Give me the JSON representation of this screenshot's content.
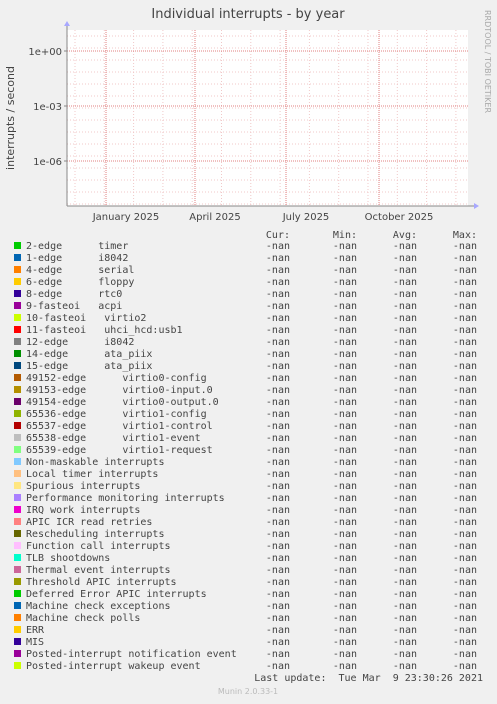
{
  "chart_data": {
    "type": "line",
    "title": "Individual interrupts - by year",
    "ylabel": "interrupts / second",
    "xlabel": "",
    "y_scale": "log",
    "y_ticks": [
      "1e+00",
      "1e-03",
      "1e-06"
    ],
    "x_ticks": [
      "January 2025",
      "April 2025",
      "July 2025",
      "October 2025"
    ],
    "grid": true,
    "side_label": "RRDTOOL / TOBI OETIKER",
    "legend_columns": [
      "Cur:",
      "Min:",
      "Avg:",
      "Max:"
    ],
    "series": [
      {
        "name": "2-edge      timer",
        "color": "#00cc00",
        "cur": "-nan",
        "min": "-nan",
        "avg": "-nan",
        "max": "-nan"
      },
      {
        "name": "1-edge      i8042",
        "color": "#0066b3",
        "cur": "-nan",
        "min": "-nan",
        "avg": "-nan",
        "max": "-nan"
      },
      {
        "name": "4-edge      serial",
        "color": "#ff8000",
        "cur": "-nan",
        "min": "-nan",
        "avg": "-nan",
        "max": "-nan"
      },
      {
        "name": "6-edge      floppy",
        "color": "#ffcc00",
        "cur": "-nan",
        "min": "-nan",
        "avg": "-nan",
        "max": "-nan"
      },
      {
        "name": "8-edge      rtc0",
        "color": "#330099",
        "cur": "-nan",
        "min": "-nan",
        "avg": "-nan",
        "max": "-nan"
      },
      {
        "name": "9-fasteoi   acpi",
        "color": "#990099",
        "cur": "-nan",
        "min": "-nan",
        "avg": "-nan",
        "max": "-nan"
      },
      {
        "name": "10-fasteoi   virtio2",
        "color": "#ccff00",
        "cur": "-nan",
        "min": "-nan",
        "avg": "-nan",
        "max": "-nan"
      },
      {
        "name": "11-fasteoi   uhci_hcd:usb1",
        "color": "#ff0000",
        "cur": "-nan",
        "min": "-nan",
        "avg": "-nan",
        "max": "-nan"
      },
      {
        "name": "12-edge      i8042",
        "color": "#808080",
        "cur": "-nan",
        "min": "-nan",
        "avg": "-nan",
        "max": "-nan"
      },
      {
        "name": "14-edge      ata_piix",
        "color": "#008f00",
        "cur": "-nan",
        "min": "-nan",
        "avg": "-nan",
        "max": "-nan"
      },
      {
        "name": "15-edge      ata_piix",
        "color": "#00487d",
        "cur": "-nan",
        "min": "-nan",
        "avg": "-nan",
        "max": "-nan"
      },
      {
        "name": "49152-edge      virtio0-config",
        "color": "#b35a00",
        "cur": "-nan",
        "min": "-nan",
        "avg": "-nan",
        "max": "-nan"
      },
      {
        "name": "49153-edge      virtio0-input.0",
        "color": "#b38f00",
        "cur": "-nan",
        "min": "-nan",
        "avg": "-nan",
        "max": "-nan"
      },
      {
        "name": "49154-edge      virtio0-output.0",
        "color": "#6b006b",
        "cur": "-nan",
        "min": "-nan",
        "avg": "-nan",
        "max": "-nan"
      },
      {
        "name": "65536-edge      virtio1-config",
        "color": "#8fb300",
        "cur": "-nan",
        "min": "-nan",
        "avg": "-nan",
        "max": "-nan"
      },
      {
        "name": "65537-edge      virtio1-control",
        "color": "#b30000",
        "cur": "-nan",
        "min": "-nan",
        "avg": "-nan",
        "max": "-nan"
      },
      {
        "name": "65538-edge      virtio1-event",
        "color": "#bebebe",
        "cur": "-nan",
        "min": "-nan",
        "avg": "-nan",
        "max": "-nan"
      },
      {
        "name": "65539-edge      virtio1-request",
        "color": "#80ff80",
        "cur": "-nan",
        "min": "-nan",
        "avg": "-nan",
        "max": "-nan"
      },
      {
        "name": "Non-maskable interrupts",
        "color": "#80c9ff",
        "cur": "-nan",
        "min": "-nan",
        "avg": "-nan",
        "max": "-nan"
      },
      {
        "name": "Local timer interrupts",
        "color": "#ffc080",
        "cur": "-nan",
        "min": "-nan",
        "avg": "-nan",
        "max": "-nan"
      },
      {
        "name": "Spurious interrupts",
        "color": "#ffe680",
        "cur": "-nan",
        "min": "-nan",
        "avg": "-nan",
        "max": "-nan"
      },
      {
        "name": "Performance monitoring interrupts",
        "color": "#aa80ff",
        "cur": "-nan",
        "min": "-nan",
        "avg": "-nan",
        "max": "-nan"
      },
      {
        "name": "IRQ work interrupts",
        "color": "#ee00cc",
        "cur": "-nan",
        "min": "-nan",
        "avg": "-nan",
        "max": "-nan"
      },
      {
        "name": "APIC ICR read retries",
        "color": "#ff8080",
        "cur": "-nan",
        "min": "-nan",
        "avg": "-nan",
        "max": "-nan"
      },
      {
        "name": "Rescheduling interrupts",
        "color": "#666600",
        "cur": "-nan",
        "min": "-nan",
        "avg": "-nan",
        "max": "-nan"
      },
      {
        "name": "Function call interrupts",
        "color": "#ffbfff",
        "cur": "-nan",
        "min": "-nan",
        "avg": "-nan",
        "max": "-nan"
      },
      {
        "name": "TLB shootdowns",
        "color": "#00ffcc",
        "cur": "-nan",
        "min": "-nan",
        "avg": "-nan",
        "max": "-nan"
      },
      {
        "name": "Thermal event interrupts",
        "color": "#cc6699",
        "cur": "-nan",
        "min": "-nan",
        "avg": "-nan",
        "max": "-nan"
      },
      {
        "name": "Threshold APIC interrupts",
        "color": "#999900",
        "cur": "-nan",
        "min": "-nan",
        "avg": "-nan",
        "max": "-nan"
      },
      {
        "name": "Deferred Error APIC interrupts",
        "color": "#00cc00",
        "cur": "-nan",
        "min": "-nan",
        "avg": "-nan",
        "max": "-nan"
      },
      {
        "name": "Machine check exceptions",
        "color": "#0066b3",
        "cur": "-nan",
        "min": "-nan",
        "avg": "-nan",
        "max": "-nan"
      },
      {
        "name": "Machine check polls",
        "color": "#ff8000",
        "cur": "-nan",
        "min": "-nan",
        "avg": "-nan",
        "max": "-nan"
      },
      {
        "name": "ERR",
        "color": "#ffcc00",
        "cur": "-nan",
        "min": "-nan",
        "avg": "-nan",
        "max": "-nan"
      },
      {
        "name": "MIS",
        "color": "#330099",
        "cur": "-nan",
        "min": "-nan",
        "avg": "-nan",
        "max": "-nan"
      },
      {
        "name": "Posted-interrupt notification event",
        "color": "#990099",
        "cur": "-nan",
        "min": "-nan",
        "avg": "-nan",
        "max": "-nan"
      },
      {
        "name": "Posted-interrupt wakeup event",
        "color": "#ccff00",
        "cur": "-nan",
        "min": "-nan",
        "avg": "-nan",
        "max": "-nan"
      }
    ],
    "last_update": "Last update:  Tue Mar  9 23:30:26 2021",
    "footer": "Munin 2.0.33-1"
  }
}
